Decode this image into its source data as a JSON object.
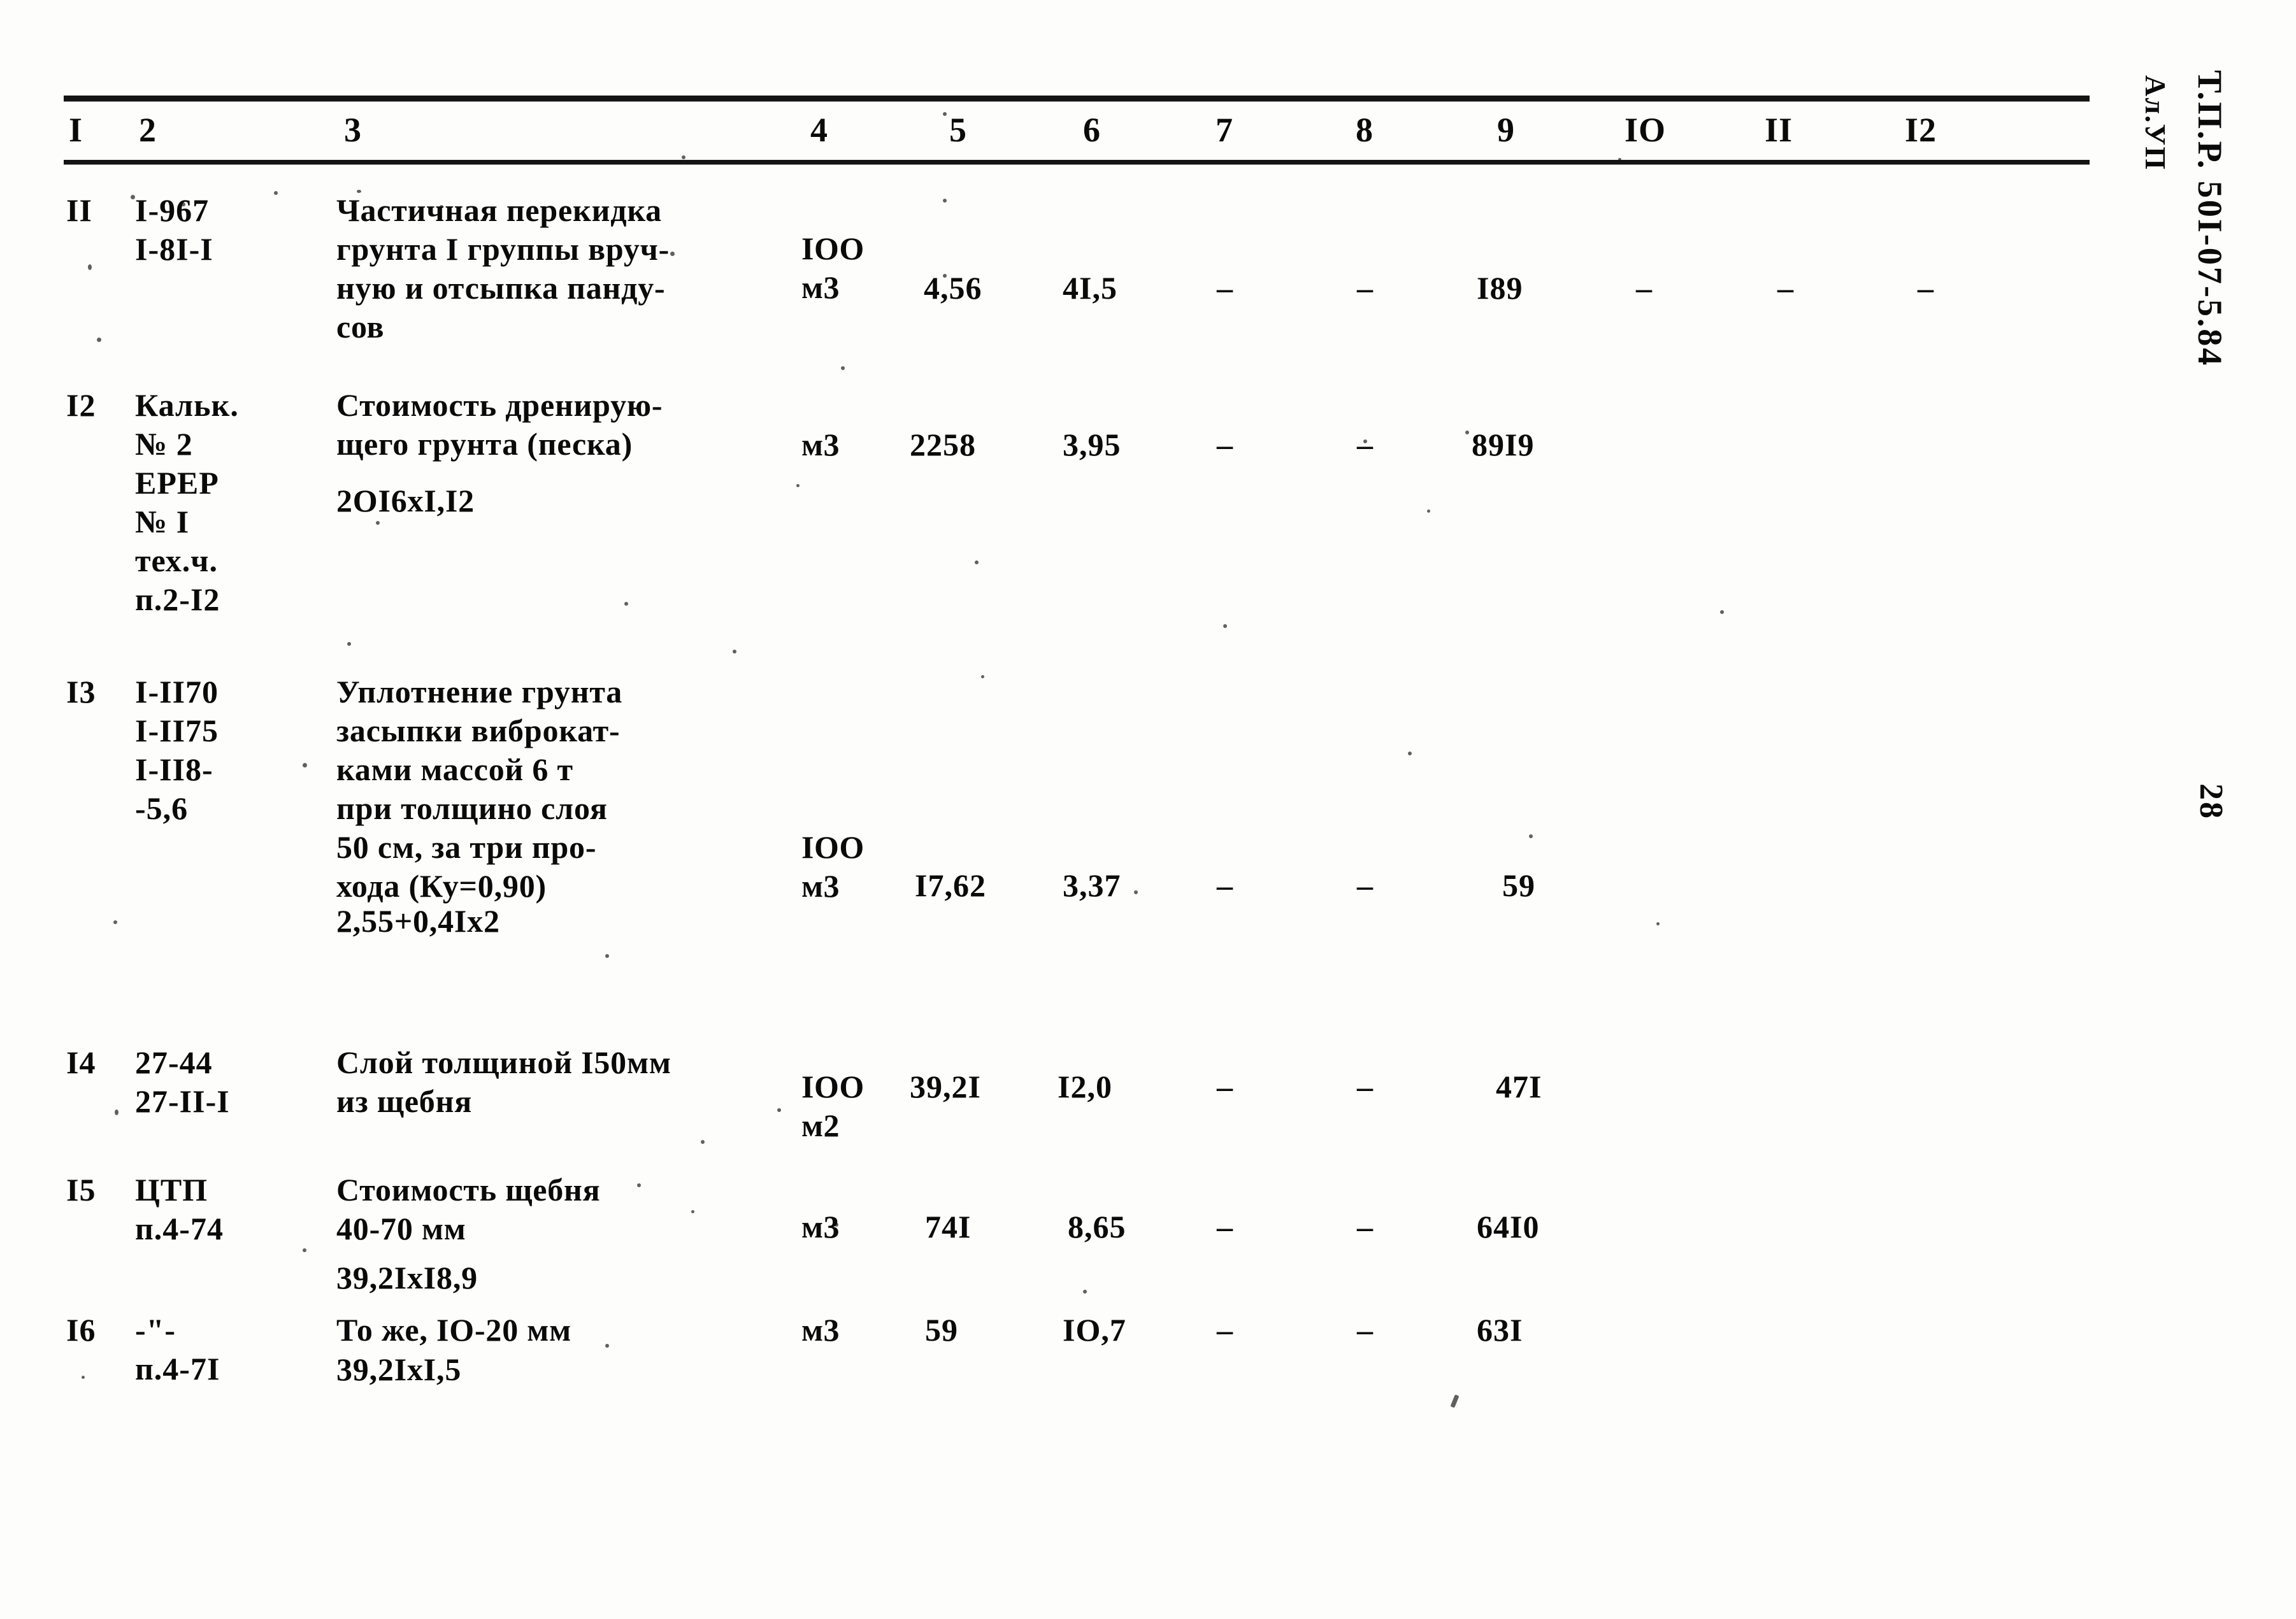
{
  "document": {
    "side_stamp_main": "Т.П.Р. 50I-07-5.84",
    "side_stamp_album": "Ал.УП",
    "page_number": "28"
  },
  "table": {
    "column_headers": [
      "I",
      "2",
      "3",
      "4",
      "5",
      "6",
      "7",
      "8",
      "9",
      "IO",
      "II",
      "I2"
    ],
    "rows": [
      {
        "no": "II",
        "code": "I-967\nI-8I-I",
        "description": "Частичная перекидка\nгрунта I группы вруч-\nную и отсыпка панду-\nсов",
        "unit": "IOO\nм3",
        "c5": "4,56",
        "c6": "4I,5",
        "c7": "–",
        "c8": "–",
        "c9": "I89",
        "c10": "–",
        "c11": "–",
        "c12": "–"
      },
      {
        "no": "I2",
        "code": "Кальк.\n№ 2\nЕРЕР\n№ I\nтех.ч.\nп.2-I2",
        "description": "Стоимость дренирую-\nщего грунта (песка)",
        "description2": "2OI6xI,I2",
        "unit": "м3",
        "c5": "2258",
        "c6": "3,95",
        "c7": "–",
        "c8": "–",
        "c9": "89I9",
        "c10": "",
        "c11": "",
        "c12": ""
      },
      {
        "no": "I3",
        "code": "I-II70\nI-II75\nI-II8-\n-5,6",
        "description": "Уплотнение грунта\nзасыпки виброкат-\nками массой 6 т\nпри толщино слоя\n50 см, за три про-\nхода (Ку=0,90)",
        "description2": "2,55+0,4Ix2",
        "unit": "IOO\nм3",
        "c5": "I7,62",
        "c6": "3,37",
        "c7": "–",
        "c8": "–",
        "c9": "59",
        "c10": "",
        "c11": "",
        "c12": ""
      },
      {
        "no": "I4",
        "code": "27-44\n27-II-I",
        "description": "Слой толщиной I50мм\nиз щебня",
        "unit": "IOO\nм2",
        "c5": "39,2I",
        "c6": "I2,0",
        "c7": "–",
        "c8": "–",
        "c9": "47I",
        "c10": "",
        "c11": "",
        "c12": ""
      },
      {
        "no": "I5",
        "code": "ЦТП\nп.4-74",
        "description": "Стоимость щебня\n40-70 мм",
        "description2": "39,2IxI8,9",
        "unit": "м3",
        "c5": "74I",
        "c6": "8,65",
        "c7": "–",
        "c8": "–",
        "c9": "64I0",
        "c10": "",
        "c11": "",
        "c12": ""
      },
      {
        "no": "I6",
        "code": "-\"-\nп.4-7I",
        "description": "То же, IO-20 мм",
        "description2": "39,2IxI,5",
        "unit": "м3",
        "c5": "59",
        "c6": "IO,7",
        "c7": "–",
        "c8": "–",
        "c9": "63I",
        "c10": "",
        "c11": "",
        "c12": ""
      }
    ]
  }
}
